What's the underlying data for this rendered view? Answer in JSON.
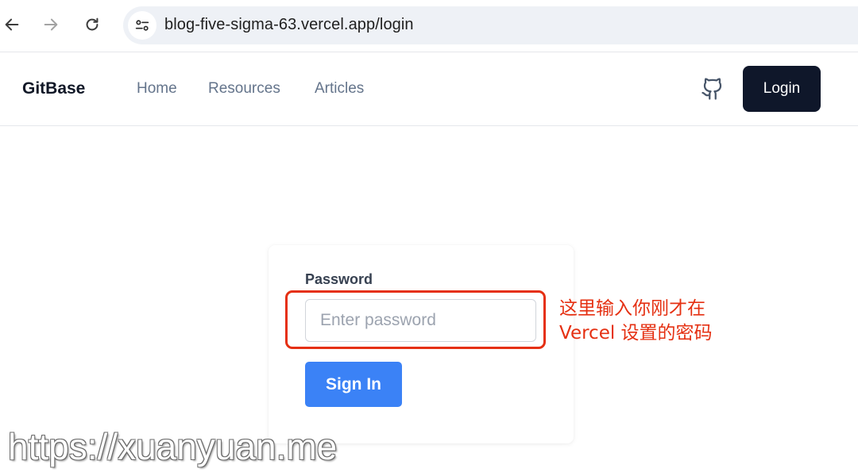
{
  "browser": {
    "url": "blog-five-sigma-63.vercel.app/login",
    "icons": [
      "back-arrow-icon",
      "forward-arrow-icon",
      "reload-icon",
      "site-settings-icon"
    ]
  },
  "header": {
    "brand": "GitBase",
    "nav": [
      {
        "label": "Home"
      },
      {
        "label": "Resources"
      },
      {
        "label": "Articles"
      }
    ],
    "github_icon": "github-icon",
    "login_label": "Login"
  },
  "login_form": {
    "password_label": "Password",
    "password_placeholder": "Enter password",
    "password_value": "",
    "sign_in_label": "Sign In"
  },
  "annotation": {
    "line1": "这里输入你刚才在",
    "line2": "Vercel 设置的密码",
    "color": "#e53012"
  },
  "watermark": {
    "text": "https://xuanyuan.me"
  },
  "colors": {
    "login_button_bg": "#0f172a",
    "sign_in_button_bg": "#3b82f6",
    "nav_link": "#64748b"
  }
}
